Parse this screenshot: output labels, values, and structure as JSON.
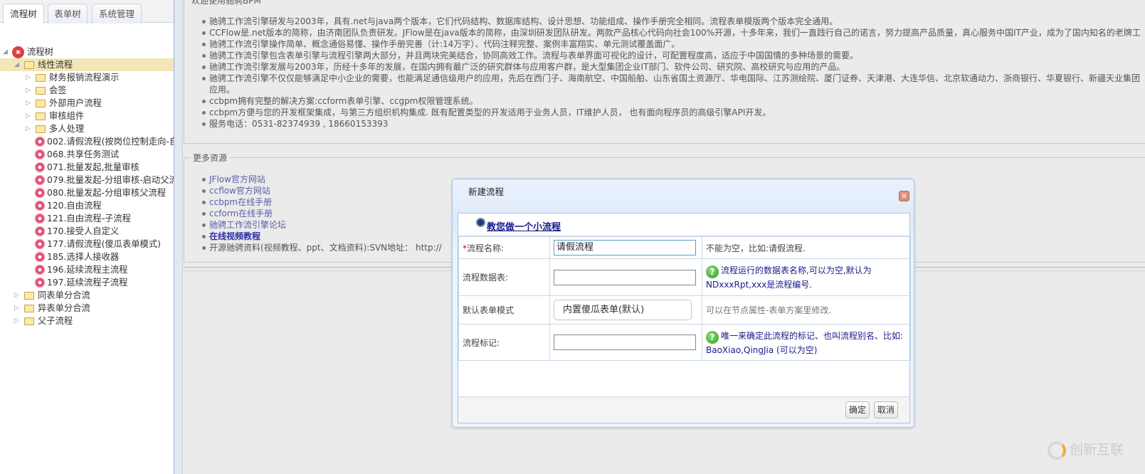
{
  "sidebar": {
    "tabs": [
      {
        "label": "流程树"
      },
      {
        "label": "表单树"
      },
      {
        "label": "系统管理"
      }
    ],
    "tree": [
      {
        "label": "流程树",
        "type": "root",
        "level": 0
      },
      {
        "label": "线性流程",
        "type": "folder",
        "level": 1,
        "selected": true
      },
      {
        "label": "财务报销流程演示",
        "type": "folder",
        "level": 2
      },
      {
        "label": "会签",
        "type": "folder",
        "level": 2
      },
      {
        "label": "外部用户流程",
        "type": "folder",
        "level": 2
      },
      {
        "label": "审核组件",
        "type": "folder",
        "level": 2
      },
      {
        "label": "多人处理",
        "type": "folder",
        "level": 2
      },
      {
        "label": "002.请假流程(按岗位控制走向-自",
        "type": "flow",
        "level": 2
      },
      {
        "label": "068.共享任务测试",
        "type": "flow",
        "level": 2
      },
      {
        "label": "071.批量发起,批量审核",
        "type": "flow",
        "level": 2
      },
      {
        "label": "079.批量发起-分组审核-启动父流",
        "type": "flow",
        "level": 2
      },
      {
        "label": "080.批量发起-分组审核父流程",
        "type": "flow",
        "level": 2
      },
      {
        "label": "120.自由流程",
        "type": "flow",
        "level": 2
      },
      {
        "label": "121.自由流程-子流程",
        "type": "flow",
        "level": 2
      },
      {
        "label": "170.接受人自定义",
        "type": "flow",
        "level": 2
      },
      {
        "label": "177.请假流程(傻瓜表单模式)",
        "type": "flow",
        "level": 2
      },
      {
        "label": "185.选择人接收器",
        "type": "flow",
        "level": 2
      },
      {
        "label": "196.延续流程主流程",
        "type": "flow",
        "level": 2
      },
      {
        "label": "197.延续流程子流程",
        "type": "flow",
        "level": 2
      },
      {
        "label": "同表单分合流",
        "type": "folder",
        "level": 1
      },
      {
        "label": "异表单分合流",
        "type": "folder",
        "level": 1
      },
      {
        "label": "父子流程",
        "type": "folder",
        "level": 1
      }
    ]
  },
  "intro": {
    "legend": "欢迎使用驰骋BPM",
    "items": [
      "驰骋工作流引擎研发与2003年，具有.net与java两个版本，它们代码结构、数据库结构、设计思想、功能组成、操作手册完全相同。流程表单模版两个版本完全通用。",
      "CCFlow是.net版本的简称，由济南团队负责研发。JFlow是在java版本的简称，由深圳研发团队研发。两款产品核心代码向社会100%开源，十多年来，我们一直践行自己的诺言，努力提高产品质量，真心服务中国IT产业，成为了国内知名的老牌工",
      "驰骋工作流引擎操作简单、概念通俗易懂、操作手册完善（计:14万字）、代码注释完整、案例丰富翔实、单元测试覆盖面广。",
      "驰骋工作流引擎包含表单引擎与流程引擎两大部分，并且两块完美结合，协同高效工作。流程与表单界面可视化的设计，可配置程度高，适应于中国国情的多种场景的需要。",
      "驰骋工作流引擎发展与2003年，历经十多年的发展，在国内拥有最广泛的研究群体与应用客户群，是大型集团企业IT部门、软件公司、研究院、高校研究与应用的产品。",
      "驰骋工作流引擎不仅仅能够满足中小企业的需要，也能满足通信级用户的应用，先后在西门子、海南航空、中国船舶、山东省国土资源厅、华电国际、江苏测绘院、厦门证券、天津港、大连华信、北京软通动力、浙商银行、华夏银行、新疆天业集团",
      "应用。",
      "ccbpm拥有完整的解决方案:ccform表单引擎、ccgpm权限管理系统。",
      "ccbpm方便与您的开发框架集成，与第三方组织机构集成. 既有配置类型的开发适用于业务人员，IT维护人员， 也有面向程序员的高级引擎API开发。",
      "服务电话：0531-82374939 , 18660153393"
    ]
  },
  "resources": {
    "legend": "更多资源",
    "links": [
      "JFlow官方网站",
      "ccflow官方网站",
      "ccbpm在线手册",
      "ccform在线手册",
      "驰骋工作流引擎论坛",
      "在线视频教程"
    ],
    "svn_text": "开源驰骋资料(视频教程、ppt、文档资料):SVN地址： http://"
  },
  "dialog": {
    "title": "新建流程",
    "guide_link": "教您做一个小流程",
    "fields": {
      "name": {
        "label": "流程名称:",
        "value": "请假流程",
        "hint": "不能为空，比如:请假流程."
      },
      "table": {
        "label": "流程数据表:",
        "value": "",
        "hint": "流程运行的数据表名称,可以为空,默认为NDxxxRpt,xxx是流程编号."
      },
      "form_mode": {
        "label": "默认表单模式",
        "value": "内置傻瓜表单(默认)",
        "hint": "可以在节点属性-表单方案里修改."
      },
      "mark": {
        "label": "流程标记:",
        "value": "",
        "hint": "唯一来确定此流程的标记、也叫流程别名、比如: BaoXiao,QingJia (可以为空)"
      }
    },
    "ok_label": "确定",
    "cancel_label": "取消"
  },
  "watermark": {
    "text": "创新互联"
  }
}
